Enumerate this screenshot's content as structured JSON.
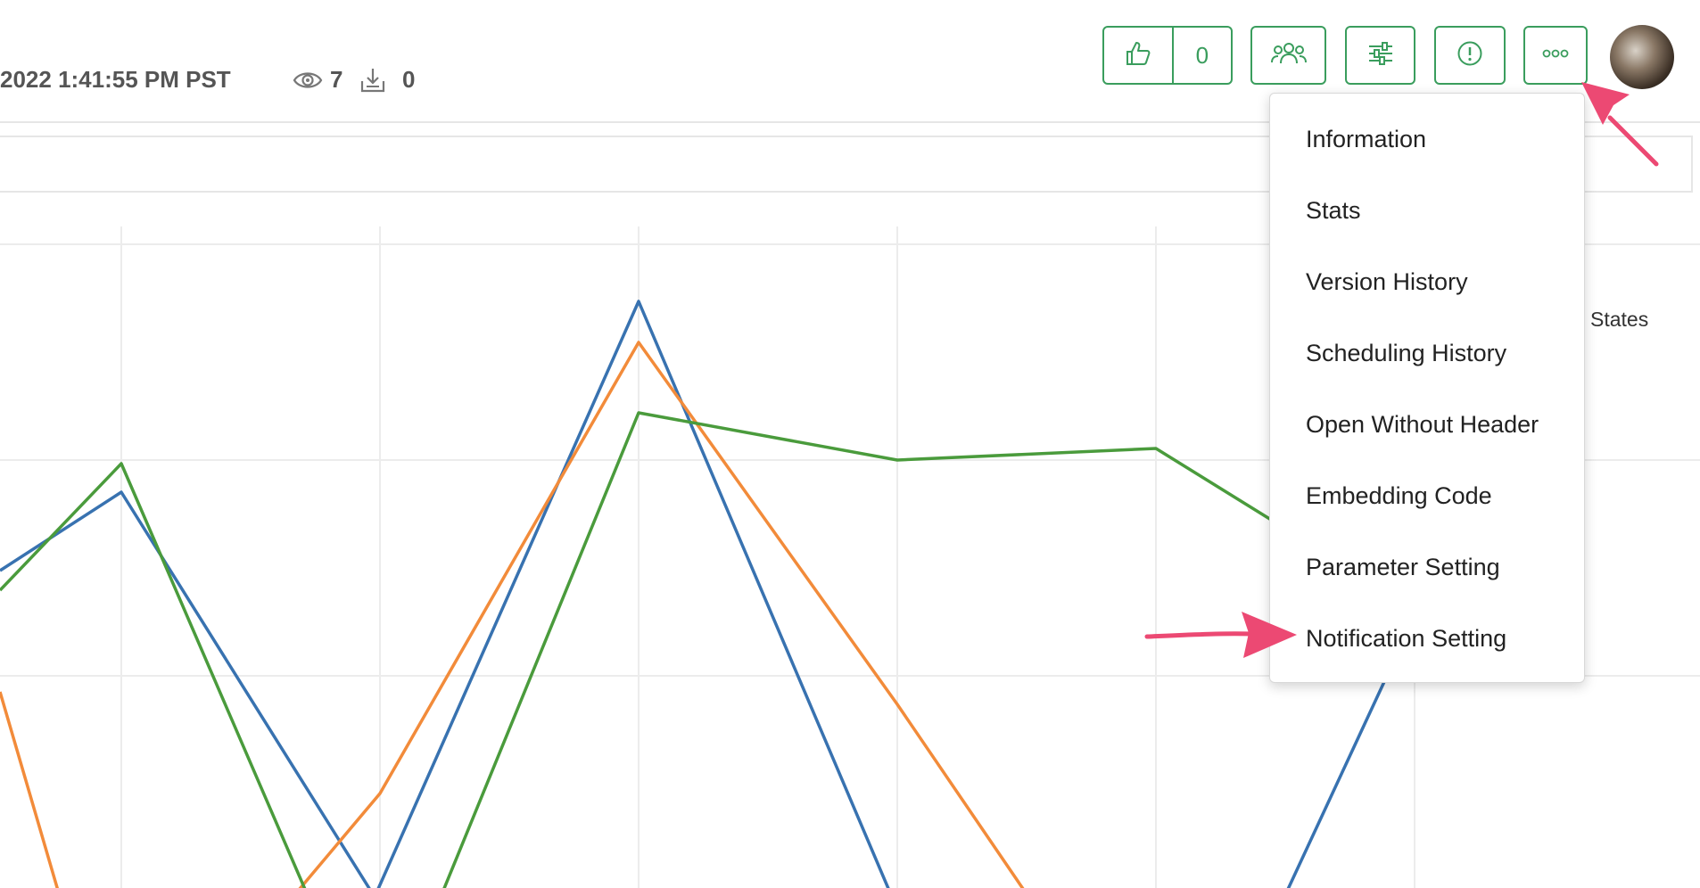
{
  "header": {
    "last_updated": "2022 1:41:55 PM PST",
    "views_count": "7",
    "downloads_count": "0"
  },
  "toolbar": {
    "like_count": "0",
    "buttons": [
      "like-icon",
      "users-icon",
      "sliders-icon",
      "info-icon",
      "more-icon"
    ],
    "accent_color": "#3a9d5d"
  },
  "dropdown_menu": {
    "items": [
      "Information",
      "Stats",
      "Version History",
      "Scheduling History",
      "Open Without Header",
      "Embedding Code",
      "Parameter Setting",
      "Notification Setting"
    ]
  },
  "chart": {
    "legend_visible_text": "States",
    "series_colors": [
      "#3872b0",
      "#f28b3a",
      "#4a9b3c"
    ],
    "gridlines": true
  },
  "annotations": {
    "arrow_color": "#ec4973"
  }
}
